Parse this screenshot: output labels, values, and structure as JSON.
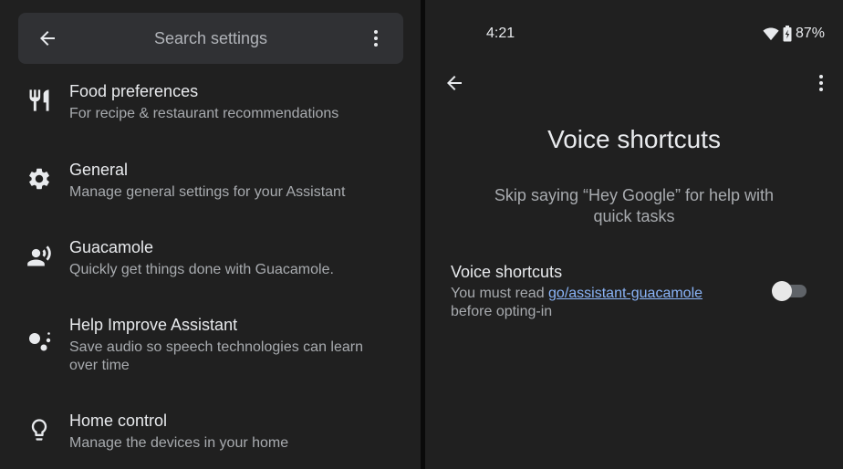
{
  "left": {
    "search": {
      "placeholder": "Search settings",
      "back_icon": "arrow-back-icon",
      "more_icon": "more-vert-icon"
    },
    "items": [
      {
        "icon": "restaurant-icon",
        "title": "Food preferences",
        "subtitle": "For recipe & restaurant recommendations"
      },
      {
        "icon": "gear-icon",
        "title": "General",
        "subtitle": "Manage general settings for your Assistant"
      },
      {
        "icon": "voice-person-icon",
        "title": "Guacamole",
        "subtitle": "Quickly get things done with Guacamole."
      },
      {
        "icon": "assistant-dots-icon",
        "title": "Help Improve Assistant",
        "subtitle": "Save audio so speech technologies can learn over time"
      },
      {
        "icon": "lightbulb-icon",
        "title": "Home control",
        "subtitle": "Manage the devices in your home"
      }
    ]
  },
  "right": {
    "status": {
      "time": "4:21",
      "battery": "87%"
    },
    "title": "Voice shortcuts",
    "description": "Skip saying “Hey Google” for help with quick tasks",
    "setting": {
      "title": "Voice shortcuts",
      "desc_prefix": "You must read ",
      "link": "go/assistant-guacamole",
      "desc_suffix": "before opting-in",
      "enabled": false
    }
  },
  "colors": {
    "background": "#202020",
    "search_bar": "#303134",
    "link": "#8ab4f8",
    "primary_text": "#e8eaed",
    "secondary_text": "#a8abaf"
  }
}
